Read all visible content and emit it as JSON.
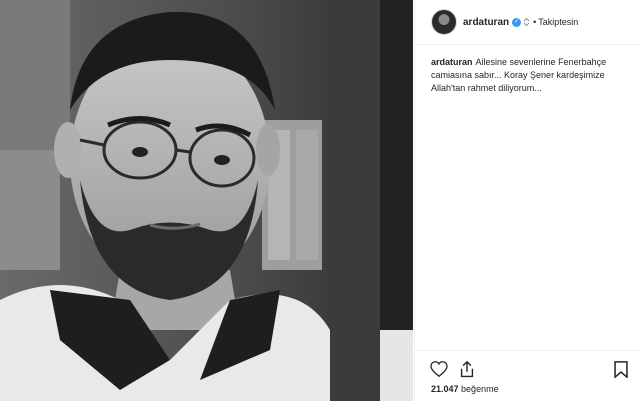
{
  "post": {
    "username": "ardaturan",
    "verified": true,
    "separator": "•",
    "follow_state": "Takiptesin",
    "caption_user": "ardaturan",
    "caption_text": "Ailesine sevenlerine Fenerbahçe camiasına sabır... Koray Şener kardeşimize Allah'tan rahmet diliyorum...",
    "likes_count": "21.047",
    "likes_label": "beğenme"
  },
  "icons": {
    "like": "heart-icon",
    "share": "share-icon",
    "save": "bookmark-icon",
    "verified": "verified-badge-icon",
    "extra": "toggle-arrows-icon"
  },
  "colors": {
    "verified_blue": "#3897f0",
    "border": "#efefef",
    "text": "#262626"
  }
}
